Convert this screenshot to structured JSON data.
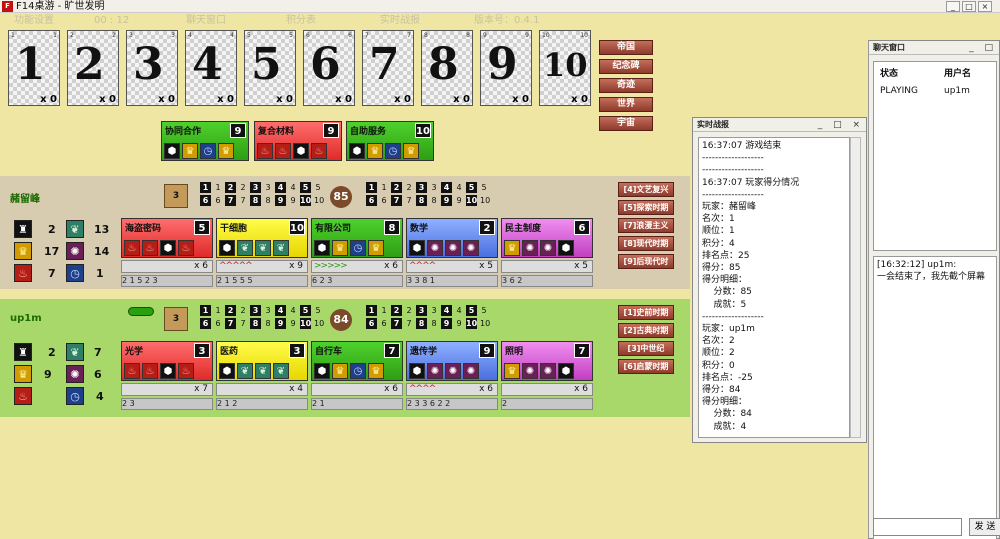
{
  "window": {
    "title": "F14桌游 - 旷世发明",
    "icon": "F",
    "buttons": [
      "_",
      "□",
      "×"
    ]
  },
  "menu": [
    "功能设置",
    "00 : 12",
    "聊天窗口",
    "积分表",
    "实时战报",
    "版本号：0.4.1"
  ],
  "era_cards": [
    {
      "num": "1",
      "count": "x 0"
    },
    {
      "num": "2",
      "count": "x 0"
    },
    {
      "num": "3",
      "count": "x 0"
    },
    {
      "num": "4",
      "count": "x 0"
    },
    {
      "num": "5",
      "count": "x 0"
    },
    {
      "num": "6",
      "count": "x 0"
    },
    {
      "num": "7",
      "count": "x 0"
    },
    {
      "num": "8",
      "count": "x 0"
    },
    {
      "num": "9",
      "count": "x 0"
    },
    {
      "num": "10",
      "count": "x 0"
    }
  ],
  "special_achievements": [
    "帝国",
    "纪念碑",
    "奇迹",
    "世界",
    "宇宙"
  ],
  "shared_cards": [
    {
      "name": "协同合作",
      "num": "9",
      "color": "green"
    },
    {
      "name": "复合材料",
      "num": "9",
      "color": "red"
    },
    {
      "name": "自助服务",
      "num": "10",
      "color": "green"
    }
  ],
  "players": [
    {
      "name": "赭留峰",
      "deck": "3",
      "score": "85",
      "resources": [
        {
          "icon": "tower-icon",
          "val": "2"
        },
        {
          "icon": "leaf-icon",
          "val": "13"
        },
        {
          "icon": "crown-icon",
          "val": "17"
        },
        {
          "icon": "bulb-icon",
          "val": "14"
        },
        {
          "icon": "factory-icon",
          "val": "7"
        },
        {
          "icon": "clock-icon",
          "val": "1"
        }
      ],
      "achievements_left": [
        "1",
        "2",
        "3",
        "4",
        "5",
        "6",
        "7",
        "8",
        "9",
        "10"
      ],
      "achievements_right": [
        "1",
        "2",
        "3",
        "4",
        "5",
        "6",
        "7",
        "8",
        "9",
        "10"
      ],
      "special": [
        "[4]文艺复兴",
        "[5]探索时期",
        "[7]浪漫主义",
        "[8]现代时期",
        "[9]后现代时"
      ],
      "cards": [
        {
          "name": "海盗密码",
          "num": "5",
          "color": "red",
          "splay": "x 6",
          "arrows": "",
          "bottom": "2 1 5 2 3"
        },
        {
          "name": "干细胞",
          "num": "10",
          "color": "yellow",
          "splay": "x 9",
          "arrows": "^^^^^",
          "bottom": "2 1 5 5 5"
        },
        {
          "name": "有限公司",
          "num": "8",
          "color": "green",
          "splay": "x 6",
          "arrows": ">>>>>",
          "bottom": "6 2 3"
        },
        {
          "name": "数学",
          "num": "2",
          "color": "blue",
          "splay": "x 5",
          "arrows": "^^^^",
          "bottom": "3 3 8 1"
        },
        {
          "name": "民主制度",
          "num": "6",
          "color": "purple",
          "splay": "x 5",
          "arrows": "",
          "bottom": "3 6 2"
        }
      ]
    },
    {
      "name": "up1m",
      "deck": "3",
      "score": "84",
      "resources": [
        {
          "icon": "tower-icon",
          "val": "2"
        },
        {
          "icon": "leaf-icon",
          "val": "7"
        },
        {
          "icon": "crown-icon",
          "val": "9"
        },
        {
          "icon": "bulb-icon",
          "val": "6"
        },
        {
          "icon": "factory-icon",
          "val": ""
        },
        {
          "icon": "clock-icon",
          "val": "4"
        }
      ],
      "achievements_left": [
        "1",
        "2",
        "3",
        "4",
        "5",
        "6",
        "7",
        "8",
        "9",
        "10"
      ],
      "achievements_right": [
        "1",
        "2",
        "3",
        "4",
        "5",
        "6",
        "7",
        "8",
        "9",
        "10"
      ],
      "special": [
        "[1]史前时期",
        "[2]古典时期",
        "[3]中世纪",
        "[6]启蒙时期"
      ],
      "cards": [
        {
          "name": "光学",
          "num": "3",
          "color": "red",
          "splay": "x 7",
          "arrows": "",
          "bottom": "2 3"
        },
        {
          "name": "医药",
          "num": "3",
          "color": "yellow",
          "splay": "x 4",
          "arrows": "",
          "bottom": "2 1 2"
        },
        {
          "name": "自行车",
          "num": "7",
          "color": "green",
          "splay": "x 6",
          "arrows": "",
          "bottom": "2 1"
        },
        {
          "name": "遗传学",
          "num": "9",
          "color": "blue",
          "splay": "x 6",
          "arrows": "^^^^",
          "bottom": "2 3 3 6 2 2"
        },
        {
          "name": "照明",
          "num": "7",
          "color": "purple",
          "splay": "x 6",
          "arrows": "",
          "bottom": "2"
        }
      ]
    }
  ],
  "battle_log": {
    "title": "实时战报",
    "lines": [
      "16:37:07 游戏结束",
      "-------------------",
      "-------------------",
      "16:37:07 玩家得分情况",
      "-------------------",
      "玩家：赭留峰",
      "名次：1",
      "顺位：1",
      "积分：4",
      "排名点：25",
      "得分：85",
      "得分明细：",
      "    分数：85",
      "    成就：5",
      "-------------------",
      "玩家：up1m",
      "名次：2",
      "顺位：2",
      "积分：0",
      "排名点：-25",
      "得分：84",
      "得分明细：",
      "    分数：84",
      "    成就：4",
      "-------------------"
    ]
  },
  "chat": {
    "title": "聊天窗口",
    "col_status": "状态",
    "col_user": "用户名",
    "rows": [
      {
        "status": "PLAYING",
        "user": "up1m"
      }
    ],
    "messages": [
      "[16:32:12] up1m:",
      "  一会结束了，我先截个屏幕"
    ],
    "send_label": "发 送"
  }
}
